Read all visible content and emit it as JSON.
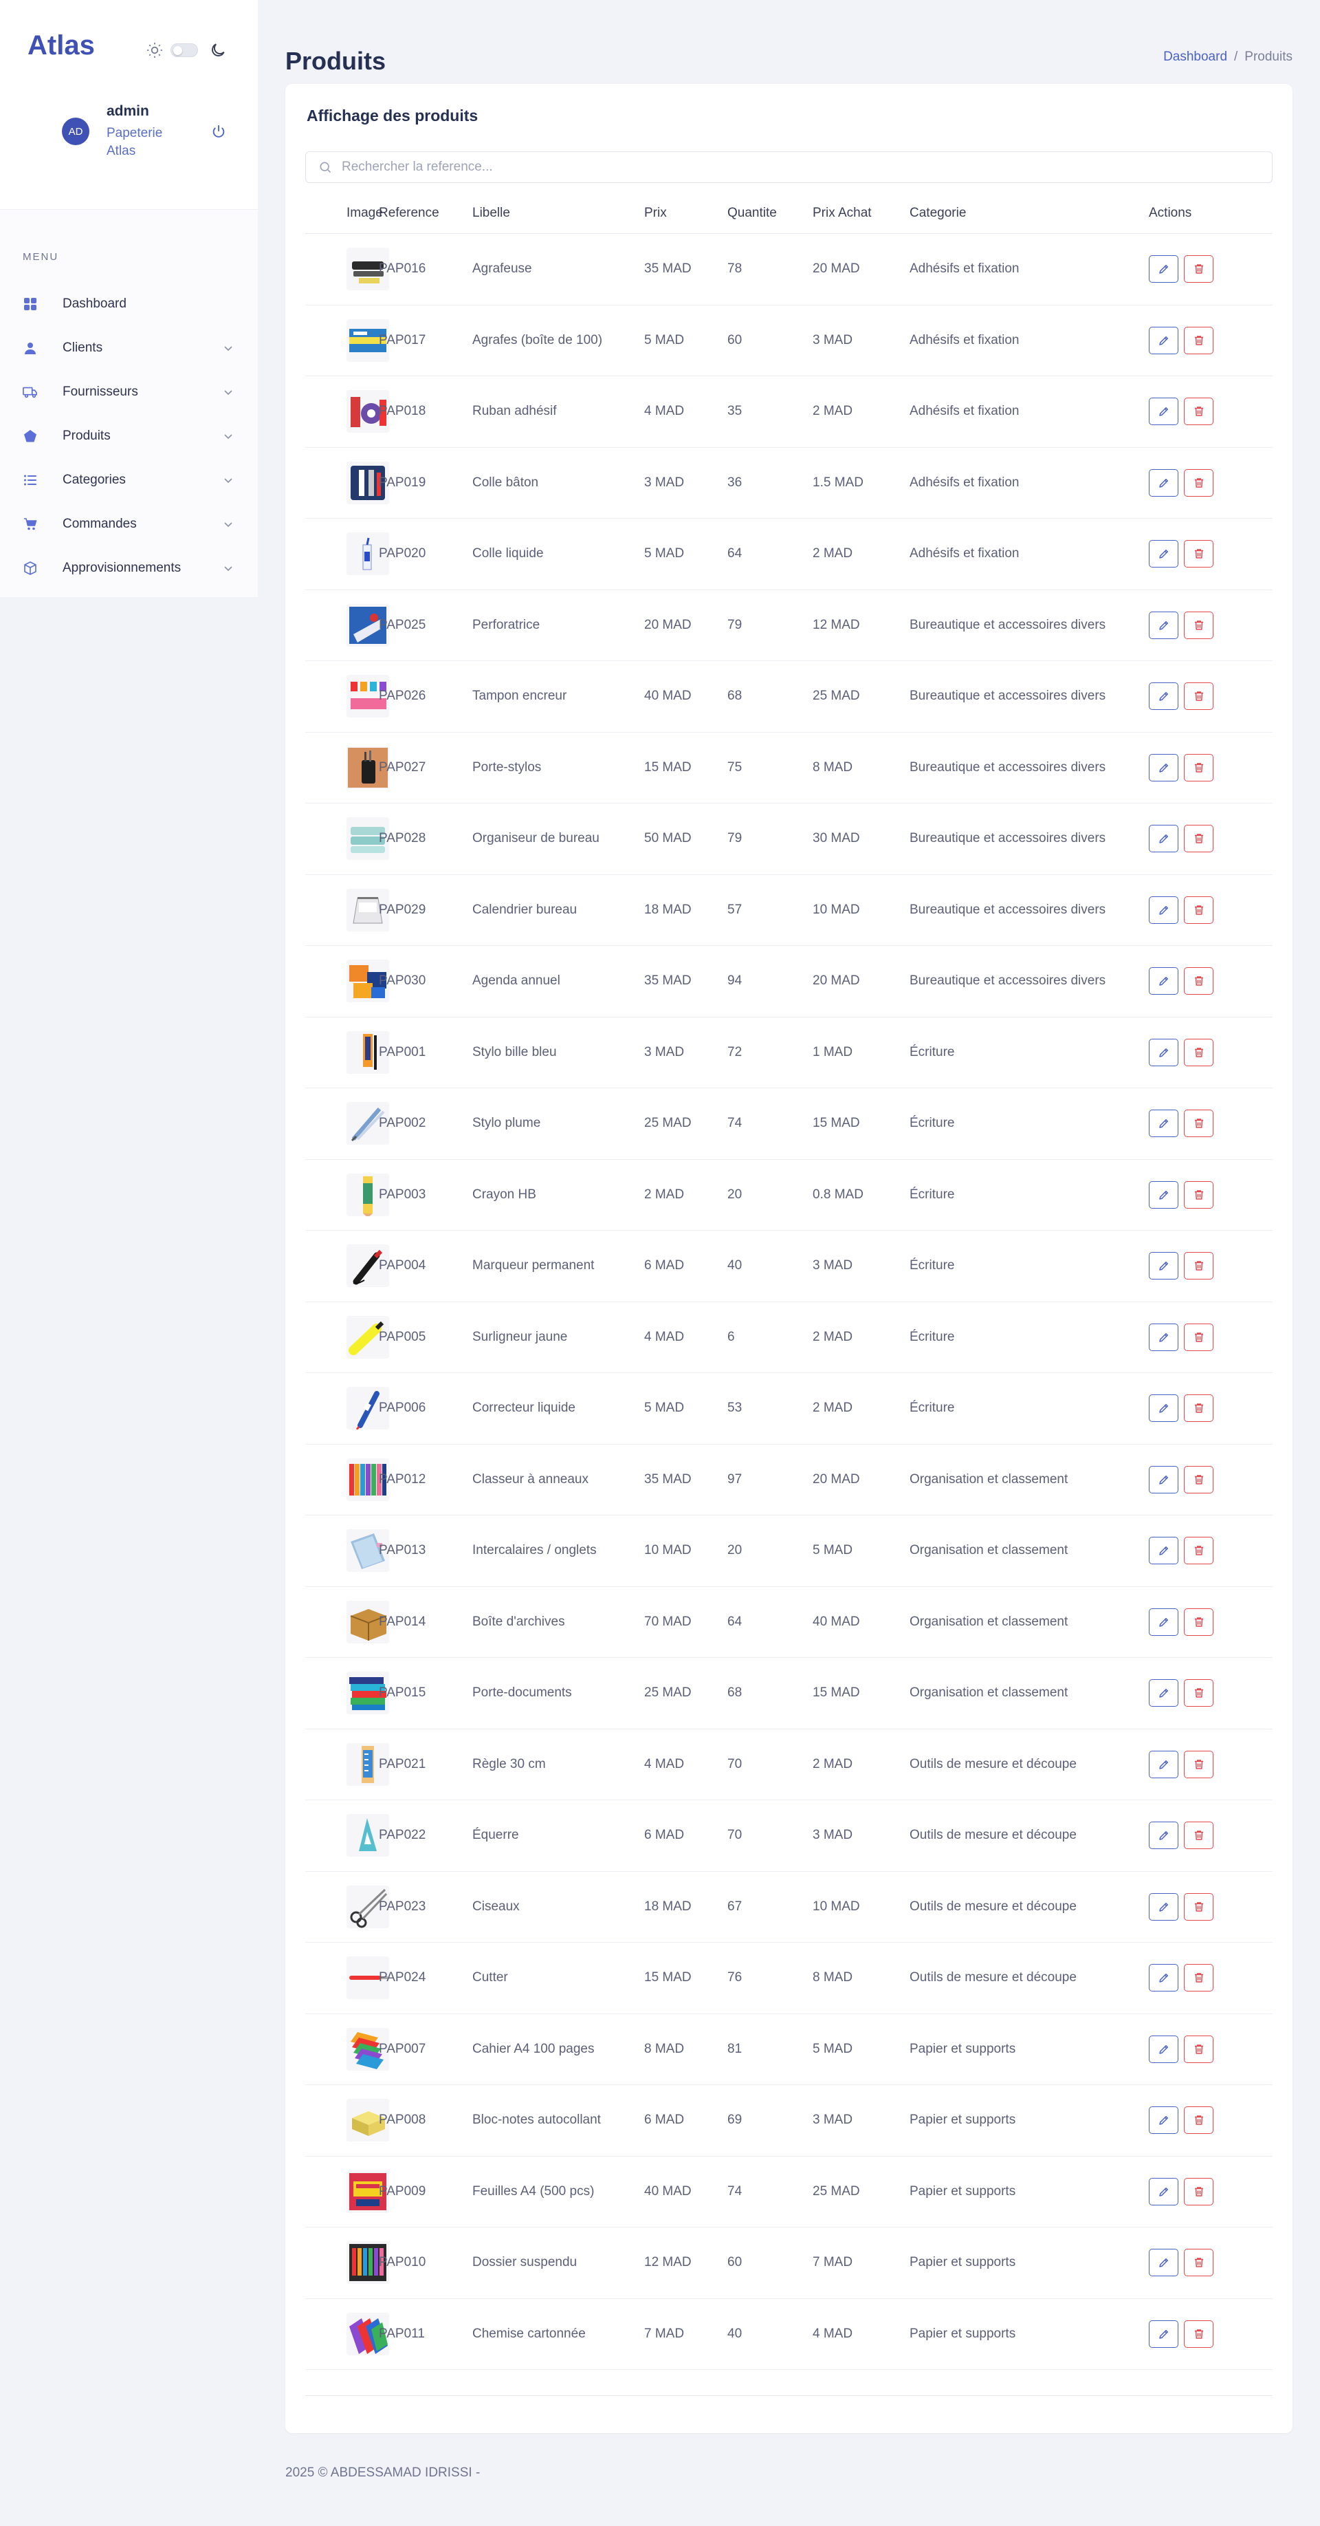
{
  "sidebar": {
    "brand": "Atlas",
    "user": {
      "initials": "AD",
      "name": "admin",
      "org": "Papeterie Atlas"
    },
    "menu_title": "MENU",
    "items": [
      {
        "label": "Dashboard",
        "icon": "grid-icon",
        "has_chevron": false
      },
      {
        "label": "Clients",
        "icon": "user-icon",
        "has_chevron": true
      },
      {
        "label": "Fournisseurs",
        "icon": "truck-icon",
        "has_chevron": true
      },
      {
        "label": "Produits",
        "icon": "pentagon-icon",
        "has_chevron": true
      },
      {
        "label": "Categories",
        "icon": "list-icon",
        "has_chevron": true
      },
      {
        "label": "Commandes",
        "icon": "cart-icon",
        "has_chevron": true
      },
      {
        "label": "Approvisionnements",
        "icon": "box-icon",
        "has_chevron": true
      }
    ]
  },
  "header": {
    "title": "Produits",
    "breadcrumb": {
      "link": "Dashboard",
      "separator": "/",
      "current": "Produits"
    }
  },
  "card": {
    "title": "Affichage des produits",
    "search_placeholder": "Rechercher la reference..."
  },
  "table": {
    "columns": [
      "Image",
      "Reference",
      "Libelle",
      "Prix",
      "Quantite",
      "Prix Achat",
      "Categorie",
      "Actions"
    ],
    "rows": [
      {
        "ref": "PAP016",
        "libelle": "Agrafeuse",
        "prix": "35 MAD",
        "quantite": "78",
        "achat": "20 MAD",
        "categorie": "Adhésifs et fixation",
        "thumb": "stapler"
      },
      {
        "ref": "PAP017",
        "libelle": "Agrafes (boîte de 100)",
        "prix": "5 MAD",
        "quantite": "60",
        "achat": "3 MAD",
        "categorie": "Adhésifs et fixation",
        "thumb": "staples-box"
      },
      {
        "ref": "PAP018",
        "libelle": "Ruban adhésif",
        "prix": "4 MAD",
        "quantite": "35",
        "achat": "2 MAD",
        "categorie": "Adhésifs et fixation",
        "thumb": "tape"
      },
      {
        "ref": "PAP019",
        "libelle": "Colle bâton",
        "prix": "3 MAD",
        "quantite": "36",
        "achat": "1.5 MAD",
        "categorie": "Adhésifs et fixation",
        "thumb": "glue-stick"
      },
      {
        "ref": "PAP020",
        "libelle": "Colle liquide",
        "prix": "5 MAD",
        "quantite": "64",
        "achat": "2 MAD",
        "categorie": "Adhésifs et fixation",
        "thumb": "liquid-glue"
      },
      {
        "ref": "PAP025",
        "libelle": "Perforatrice",
        "prix": "20 MAD",
        "quantite": "79",
        "achat": "12 MAD",
        "categorie": "Bureautique et accessoires divers",
        "thumb": "hole-punch"
      },
      {
        "ref": "PAP026",
        "libelle": "Tampon encreur",
        "prix": "40 MAD",
        "quantite": "68",
        "achat": "25 MAD",
        "categorie": "Bureautique et accessoires divers",
        "thumb": "ink-pad"
      },
      {
        "ref": "PAP027",
        "libelle": "Porte-stylos",
        "prix": "15 MAD",
        "quantite": "75",
        "achat": "8 MAD",
        "categorie": "Bureautique et accessoires divers",
        "thumb": "pen-holder"
      },
      {
        "ref": "PAP028",
        "libelle": "Organiseur de bureau",
        "prix": "50 MAD",
        "quantite": "79",
        "achat": "30 MAD",
        "categorie": "Bureautique et accessoires divers",
        "thumb": "desk-organizer"
      },
      {
        "ref": "PAP029",
        "libelle": "Calendrier bureau",
        "prix": "18 MAD",
        "quantite": "57",
        "achat": "10 MAD",
        "categorie": "Bureautique et accessoires divers",
        "thumb": "desk-calendar"
      },
      {
        "ref": "PAP030",
        "libelle": "Agenda annuel",
        "prix": "35 MAD",
        "quantite": "94",
        "achat": "20 MAD",
        "categorie": "Bureautique et accessoires divers",
        "thumb": "agenda"
      },
      {
        "ref": "PAP001",
        "libelle": "Stylo bille bleu",
        "prix": "3 MAD",
        "quantite": "72",
        "achat": "1 MAD",
        "categorie": "Écriture",
        "thumb": "ballpoint-pen"
      },
      {
        "ref": "PAP002",
        "libelle": "Stylo plume",
        "prix": "25 MAD",
        "quantite": "74",
        "achat": "15 MAD",
        "categorie": "Écriture",
        "thumb": "fountain-pen"
      },
      {
        "ref": "PAP003",
        "libelle": "Crayon HB",
        "prix": "2 MAD",
        "quantite": "20",
        "achat": "0.8 MAD",
        "categorie": "Écriture",
        "thumb": "pencil"
      },
      {
        "ref": "PAP004",
        "libelle": "Marqueur permanent",
        "prix": "6 MAD",
        "quantite": "40",
        "achat": "3 MAD",
        "categorie": "Écriture",
        "thumb": "marker"
      },
      {
        "ref": "PAP005",
        "libelle": "Surligneur jaune",
        "prix": "4 MAD",
        "quantite": "6",
        "achat": "2 MAD",
        "categorie": "Écriture",
        "thumb": "highlighter"
      },
      {
        "ref": "PAP006",
        "libelle": "Correcteur liquide",
        "prix": "5 MAD",
        "quantite": "53",
        "achat": "2 MAD",
        "categorie": "Écriture",
        "thumb": "correction-pen"
      },
      {
        "ref": "PAP012",
        "libelle": "Classeur à anneaux",
        "prix": "35 MAD",
        "quantite": "97",
        "achat": "20 MAD",
        "categorie": "Organisation et classement",
        "thumb": "binders"
      },
      {
        "ref": "PAP013",
        "libelle": "Intercalaires / onglets",
        "prix": "10 MAD",
        "quantite": "20",
        "achat": "5 MAD",
        "categorie": "Organisation et classement",
        "thumb": "dividers"
      },
      {
        "ref": "PAP014",
        "libelle": "Boîte d'archives",
        "prix": "70 MAD",
        "quantite": "64",
        "achat": "40 MAD",
        "categorie": "Organisation et classement",
        "thumb": "archive-box"
      },
      {
        "ref": "PAP015",
        "libelle": "Porte-documents",
        "prix": "25 MAD",
        "quantite": "68",
        "achat": "15 MAD",
        "categorie": "Organisation et classement",
        "thumb": "document-holder"
      },
      {
        "ref": "PAP021",
        "libelle": "Règle 30 cm",
        "prix": "4 MAD",
        "quantite": "70",
        "achat": "2 MAD",
        "categorie": "Outils de mesure et découpe",
        "thumb": "ruler"
      },
      {
        "ref": "PAP022",
        "libelle": "Équerre",
        "prix": "6 MAD",
        "quantite": "70",
        "achat": "3 MAD",
        "categorie": "Outils de mesure et découpe",
        "thumb": "set-square"
      },
      {
        "ref": "PAP023",
        "libelle": "Ciseaux",
        "prix": "18 MAD",
        "quantite": "67",
        "achat": "10 MAD",
        "categorie": "Outils de mesure et découpe",
        "thumb": "scissors"
      },
      {
        "ref": "PAP024",
        "libelle": "Cutter",
        "prix": "15 MAD",
        "quantite": "76",
        "achat": "8 MAD",
        "categorie": "Outils de mesure et découpe",
        "thumb": "cutter"
      },
      {
        "ref": "PAP007",
        "libelle": "Cahier A4 100 pages",
        "prix": "8 MAD",
        "quantite": "81",
        "achat": "5 MAD",
        "categorie": "Papier et supports",
        "thumb": "notebook"
      },
      {
        "ref": "PAP008",
        "libelle": "Bloc-notes autocollant",
        "prix": "6 MAD",
        "quantite": "69",
        "achat": "3 MAD",
        "categorie": "Papier et supports",
        "thumb": "sticky-notes"
      },
      {
        "ref": "PAP009",
        "libelle": "Feuilles A4 (500 pcs)",
        "prix": "40 MAD",
        "quantite": "74",
        "achat": "25 MAD",
        "categorie": "Papier et supports",
        "thumb": "paper-ream"
      },
      {
        "ref": "PAP010",
        "libelle": "Dossier suspendu",
        "prix": "12 MAD",
        "quantite": "60",
        "achat": "7 MAD",
        "categorie": "Papier et supports",
        "thumb": "hanging-folder"
      },
      {
        "ref": "PAP011",
        "libelle": "Chemise cartonnée",
        "prix": "7 MAD",
        "quantite": "40",
        "achat": "4 MAD",
        "categorie": "Papier et supports",
        "thumb": "cardboard-folder"
      }
    ]
  },
  "footer": {
    "text": "2025 © ABDESSAMAD IDRISSI -"
  },
  "colors": {
    "accent": "#3f51b5",
    "link": "#4a62c8",
    "danger": "#e5484d",
    "background": "#f2f3f8"
  }
}
